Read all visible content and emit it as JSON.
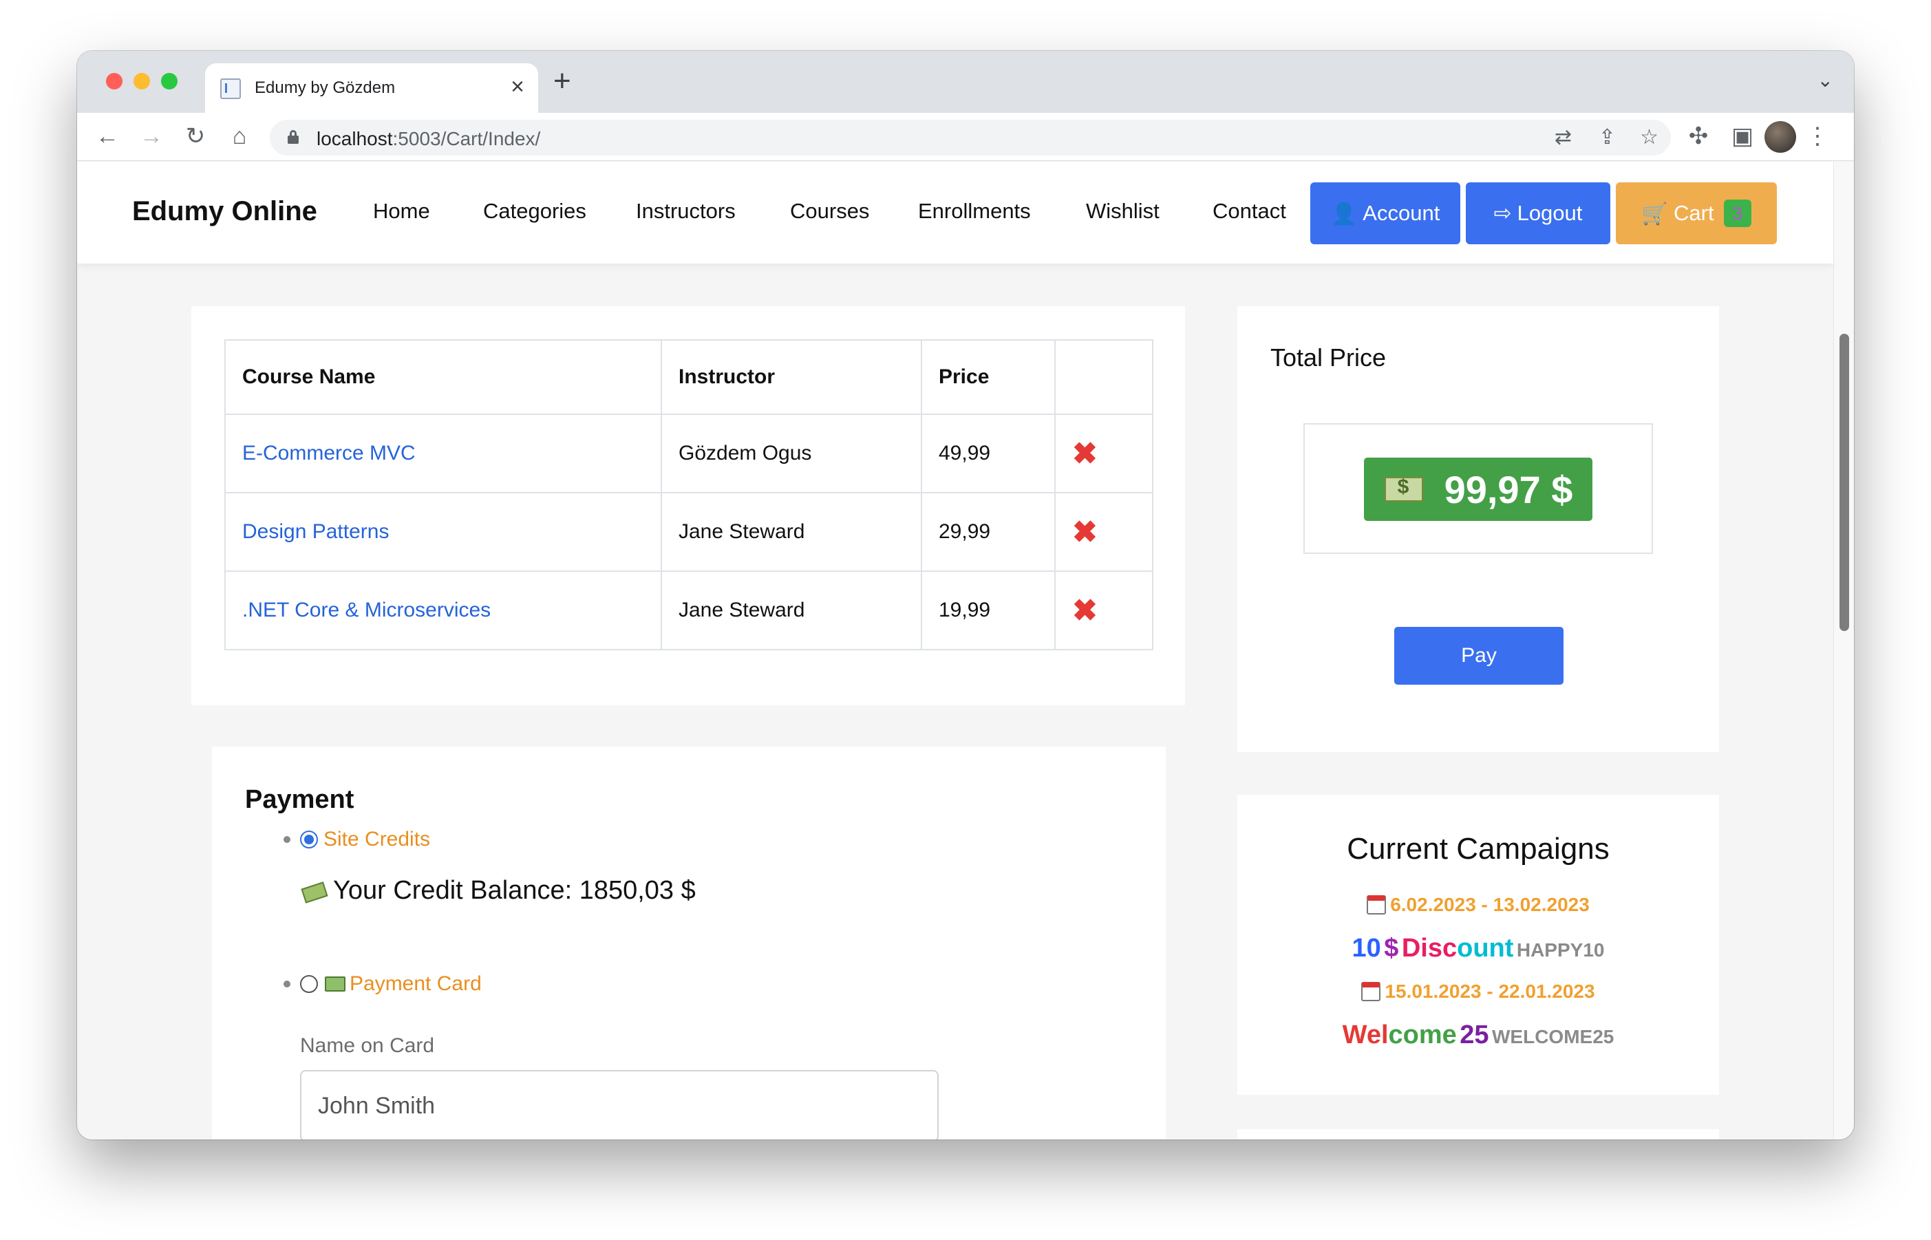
{
  "browser": {
    "tab_title": "Edumy by Gözdem",
    "url_host": "localhost",
    "url_path": ":5003/Cart/Index/"
  },
  "navbar": {
    "brand": "Edumy Online",
    "links": [
      "Home",
      "Categories",
      "Instructors",
      "Courses",
      "Enrollments",
      "Wishlist",
      "Contact"
    ],
    "account_label": "Account",
    "logout_label": "Logout",
    "cart_label": "Cart",
    "cart_count": "3"
  },
  "cart_table": {
    "headers": [
      "Course Name",
      "Instructor",
      "Price",
      ""
    ],
    "rows": [
      {
        "course": "E-Commerce MVC",
        "instructor": "Gözdem Ogus",
        "price": "49,99"
      },
      {
        "course": "Design Patterns",
        "instructor": "Jane Steward",
        "price": "29,99"
      },
      {
        "course": ".NET Core & Microservices",
        "instructor": "Jane Steward",
        "price": "19,99"
      }
    ]
  },
  "total": {
    "title": "Total Price",
    "value": "99,97 $",
    "pay_label": "Pay"
  },
  "payment": {
    "title": "Payment",
    "option_credits": "Site Credits",
    "credit_balance": "Your Credit Balance: 1850,03 $",
    "option_card": "Payment Card",
    "name_label": "Name on Card",
    "name_value": "John Smith"
  },
  "campaigns": {
    "title": "Current Campaigns",
    "items": [
      {
        "dates": "6.02.2023 - 13.02.2023",
        "name_parts": [
          "10",
          "$",
          "Disc",
          "ount"
        ],
        "code": "HAPPY10"
      },
      {
        "dates": "15.01.2023 - 22.01.2023",
        "name_parts": [
          "Wel",
          "come",
          "25"
        ],
        "code": "WELCOME25"
      }
    ]
  },
  "colors": {
    "primary": "#3a6ff0",
    "warning": "#f0ad4e",
    "success": "#43a047",
    "danger": "#e53935",
    "link": "#2563d9",
    "accent_orange": "#e98e1f"
  }
}
